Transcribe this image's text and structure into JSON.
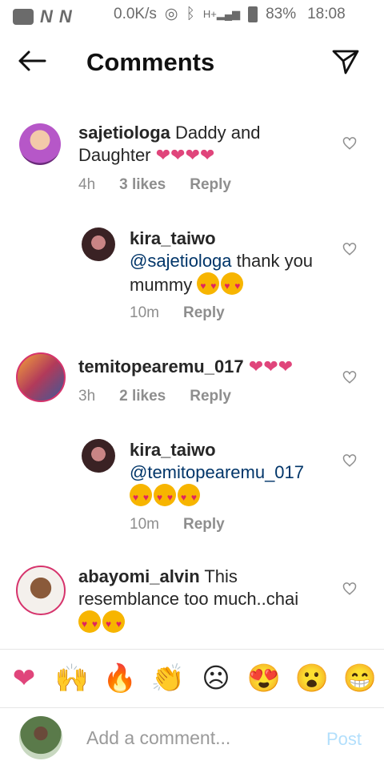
{
  "status": {
    "speed": "0.0K/s",
    "net": "H+",
    "battery": "83%",
    "time": "18:08"
  },
  "header": {
    "title": "Comments"
  },
  "comments": [
    {
      "user": "sajetiologa",
      "text": " Daddy and Daughter ",
      "time": "4h",
      "likes": "3 likes",
      "reply": "Reply"
    },
    {
      "user": "kira_taiwo",
      "mention": "@sajetiologa",
      "text": " thank you mummy ",
      "time": "10m",
      "reply": "Reply"
    },
    {
      "user": "temitopearemu_017",
      "text": "",
      "time": "3h",
      "likes": "2 likes",
      "reply": "Reply"
    },
    {
      "user": "kira_taiwo",
      "mention": "@temitopearemu_017",
      "text": "",
      "time": "10m",
      "reply": "Reply"
    },
    {
      "user": "abayomi_alvin",
      "text": " This resemblance too much..chai",
      "time": "",
      "likes": "",
      "reply": ""
    }
  ],
  "reactions": [
    "heart",
    "raised-hands",
    "fire",
    "clapping-hands",
    "sad-face",
    "heart-eyes-face",
    "surprised-face",
    "grinning-face"
  ],
  "input": {
    "placeholder": "Add a comment...",
    "post": "Post"
  }
}
